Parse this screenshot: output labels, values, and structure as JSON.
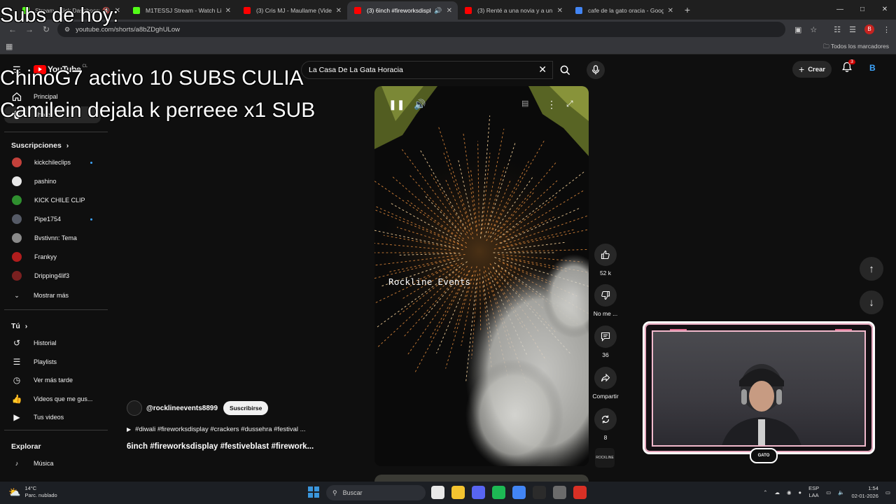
{
  "browser": {
    "tabs": [
      {
        "label": "Stream - Kick Dashboard",
        "color": "#53fc18",
        "active": false,
        "muted": true
      },
      {
        "label": "M1TESSJ Stream - Watch Live o",
        "color": "#53fc18",
        "active": false,
        "muted": false
      },
      {
        "label": "(3) Cris MJ - Maullame (Video C",
        "color": "#ff0000",
        "active": false,
        "muted": false
      },
      {
        "label": "(3) 6inch #fireworksdisplay",
        "color": "#ff0000",
        "active": true,
        "muted": false
      },
      {
        "label": "(3) Renté a una novia y a un ho",
        "color": "#ff0000",
        "active": false,
        "muted": false
      },
      {
        "label": "cafe de la gato oracia - Google",
        "color": "#4285f4",
        "active": false,
        "muted": false
      }
    ],
    "url": "youtube.com/shorts/a8bZDghULow",
    "bookmarks_right": "Todos los marcadores",
    "profile_initial": "B"
  },
  "youtube": {
    "logo_text": "YouTube",
    "country_code": "CL",
    "search_value": "La Casa De La Gata Horacia",
    "create_label": "Crear",
    "notif_count": "3",
    "sidebar": {
      "main": [
        {
          "label": "Principal",
          "icon": "home-icon"
        },
        {
          "label": "Shorts",
          "icon": "shorts-icon"
        }
      ],
      "subs_heading": "Suscripciones",
      "subs": [
        {
          "label": "kickchileclips",
          "color": "#c3413b",
          "dot": true
        },
        {
          "label": "pashino",
          "color": "#e8e8e8",
          "dot": false
        },
        {
          "label": "KICK CHILE CLIP",
          "color": "#2f8f2f",
          "dot": false
        },
        {
          "label": "Pipe1754",
          "color": "#555a66",
          "dot": true
        },
        {
          "label": "Bvstivnn: Tema",
          "color": "#8a8a8a",
          "dot": false
        },
        {
          "label": "Frankyy",
          "color": "#b01d1d",
          "dot": false
        },
        {
          "label": "Dripping4lif3",
          "color": "#7a2020",
          "dot": false
        }
      ],
      "show_more": "Mostrar más",
      "you_heading": "Tú",
      "you": [
        {
          "label": "Historial",
          "icon": "history-icon"
        },
        {
          "label": "Playlists",
          "icon": "playlists-icon"
        },
        {
          "label": "Ver más tarde",
          "icon": "watch-later-icon"
        },
        {
          "label": "Videos que me gus...",
          "icon": "liked-icon"
        },
        {
          "label": "Tus videos",
          "icon": "your-videos-icon"
        }
      ],
      "explore_heading": "Explorar",
      "explore": [
        {
          "label": "Música",
          "icon": "music-icon"
        }
      ]
    },
    "short": {
      "watermark": "Rockline Events",
      "channel_handle": "@rocklineevents8899",
      "subscribe_label": "Suscribirse",
      "tags": "#diwali #fireworksdisplay #crackers #dussehra #festival ...",
      "title": "6inch #fireworksdisplay #festiveblast #firework...",
      "likes": "52 k",
      "dislike_label": "No me ...",
      "comments": "36",
      "share_label": "Compartir",
      "remix": "8",
      "channel_thumb_text": "ROCKLINE"
    }
  },
  "overlay": {
    "title": "Subs de hoy:",
    "line1": "ChinoG7 activo 10 SUBS CULIA",
    "line2": "Camilein dejala k perreee x1 SUB"
  },
  "webcam": {
    "badge_text": "GATO"
  },
  "taskbar": {
    "temp": "14°C",
    "weather_desc": "Parc. nublado",
    "search_placeholder": "Buscar",
    "lang_top": "ESP",
    "lang_bottom": "LAA",
    "time": "1:54",
    "date": "02-01-2026",
    "apps": [
      "#e8e8e8",
      "#f4c430",
      "#5865f2",
      "#1db954",
      "#4285f4",
      "#2b2b2b",
      "#6b6b6b",
      "#d93025"
    ]
  }
}
